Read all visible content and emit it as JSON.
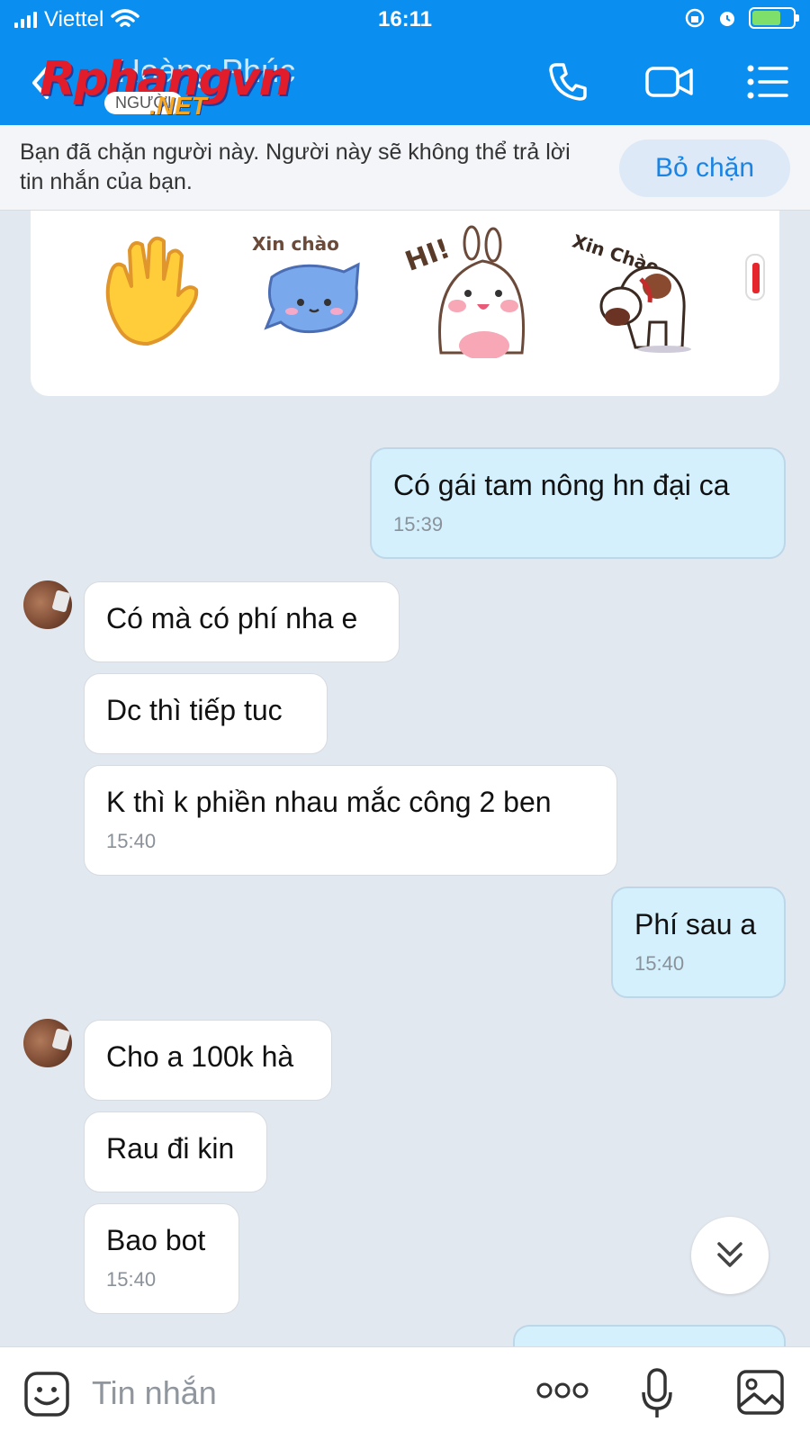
{
  "status_bar": {
    "carrier": "Viettel",
    "time": "16:11"
  },
  "header": {
    "contact_name": "Hoàng Phúc",
    "watermark": {
      "main": "Rphangvn",
      "sub": "NGƯỜI",
      "net": ".NET"
    },
    "icons": [
      "back-icon",
      "phone-icon",
      "video-call-icon",
      "menu-icon"
    ]
  },
  "banner": {
    "text": "Bạn đã chặn người này. Người này sẽ không thể trả lời tin nhắn của bạn.",
    "unblock_label": "Bỏ chặn"
  },
  "stickers": [
    {
      "name": "waving-hand-sticker"
    },
    {
      "name": "blue-cat-sticker",
      "caption": "Xin chào"
    },
    {
      "name": "bunny-hi-sticker",
      "caption": "HI!"
    },
    {
      "name": "dog-bow-sticker",
      "caption": "Xin Chào"
    }
  ],
  "messages": [
    {
      "side": "out",
      "text": "Có gái tam nông hn đại ca",
      "time": "15:39"
    },
    {
      "side": "in",
      "text": "Có mà có phí nha e"
    },
    {
      "side": "in",
      "text": "Dc thì tiếp tuc"
    },
    {
      "side": "in",
      "text": "K thì k phiền nhau mắc công 2 ben",
      "time": "15:40"
    },
    {
      "side": "out",
      "text": "Phí sau a",
      "time": "15:40"
    },
    {
      "side": "in",
      "text": "Cho a 100k hà"
    },
    {
      "side": "in",
      "text": "Rau đi kin"
    },
    {
      "side": "in",
      "text": "Bao bot",
      "time": "15:40"
    }
  ],
  "input_bar": {
    "placeholder": "Tin nhắn"
  },
  "colors": {
    "header": "#0a8ff0",
    "outgoing": "#d4f0fd",
    "incoming": "#ffffff",
    "accent": "#1a84e4"
  }
}
